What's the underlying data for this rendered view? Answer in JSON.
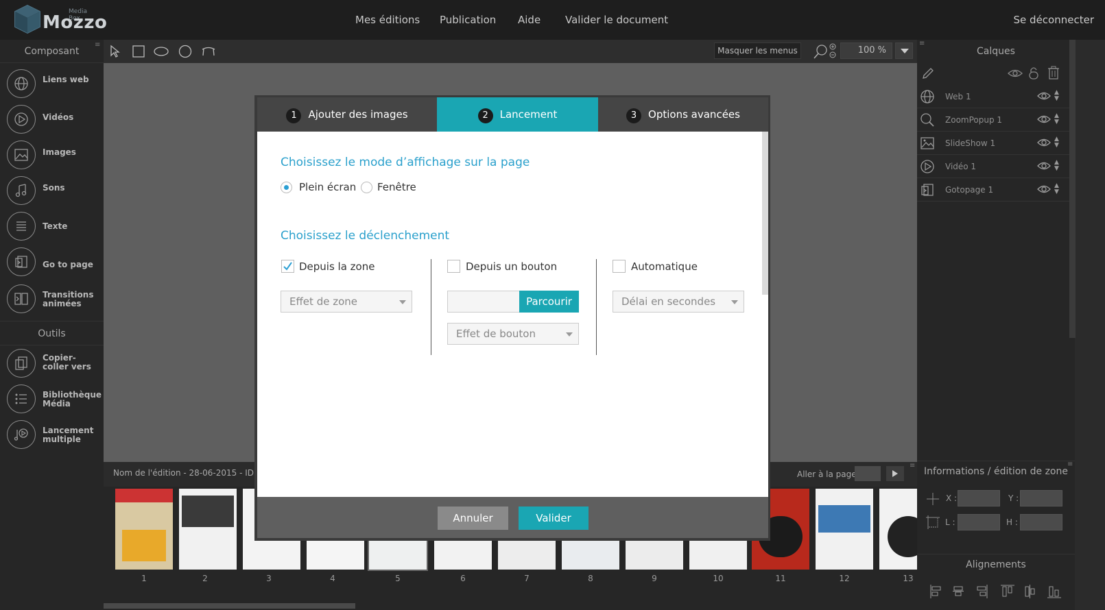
{
  "app": {
    "brand": "Mozzo",
    "brand_sub": "Media Box"
  },
  "nav": {
    "items": [
      "Mes éditions",
      "Publication",
      "Aide",
      "Valider le document"
    ],
    "logout": "Se déconnecter"
  },
  "left_panel": {
    "title": "Composant",
    "items": [
      {
        "label": "Liens web",
        "icon": "globe-icon"
      },
      {
        "label": "Vidéos",
        "icon": "play-icon"
      },
      {
        "label": "Images",
        "icon": "image-icon"
      },
      {
        "label": "Sons",
        "icon": "music-note-icon"
      },
      {
        "label": "Texte",
        "icon": "text-lines-icon"
      },
      {
        "label": "Go to page",
        "icon": "goto-page-icon"
      },
      {
        "label": "Transitions animées",
        "icon": "transitions-icon"
      }
    ],
    "tools_title": "Outils",
    "tools": [
      {
        "label": "Copier-coller vers",
        "icon": "copy-icon"
      },
      {
        "label": "Bibliothèque Média",
        "icon": "list-icon"
      },
      {
        "label": "Lancement multiple",
        "icon": "multi-launch-icon"
      }
    ]
  },
  "toolbar": {
    "hide_menus": "Masquer les menus",
    "zoom": "100 %"
  },
  "right_panel": {
    "title": "Calques",
    "layers": [
      {
        "name": "Web 1",
        "icon": "globe-icon"
      },
      {
        "name": "ZoomPopup 1",
        "icon": "zoom-icon"
      },
      {
        "name": "SlideShow 1",
        "icon": "image-icon"
      },
      {
        "name": "Vidéo 1",
        "icon": "play-icon"
      },
      {
        "name": "Gotopage 1",
        "icon": "goto-page-icon"
      }
    ],
    "info_title": "Informations / édition de zone",
    "x_label": "X :",
    "y_label": "Y :",
    "w_label": "L :",
    "h_label": "H :",
    "align_title": "Alignements"
  },
  "bottom": {
    "edition_name": "Nom de l'édition - 28-06-2015 - ID",
    "goto_label": "Aller à la page",
    "pages": [
      "1",
      "2",
      "3",
      "4",
      "5",
      "6",
      "7",
      "8",
      "9",
      "10",
      "11",
      "12",
      "13"
    ]
  },
  "modal": {
    "tabs": [
      {
        "num": "1",
        "label": "Ajouter des images"
      },
      {
        "num": "2",
        "label": "Lancement"
      },
      {
        "num": "3",
        "label": "Options avancées"
      }
    ],
    "display_title": "Choisissez le mode d’affichage sur la page",
    "display_options": [
      "Plein écran",
      "Fenêtre"
    ],
    "trigger_title": "Choisissez le déclenchement",
    "trigger_zone": "Depuis la zone",
    "trigger_button": "Depuis un bouton",
    "trigger_auto": "Automatique",
    "zone_effect": "Effet de zone",
    "browse": "Parcourir",
    "button_effect": "Effet de bouton",
    "delay": "Délai en secondes",
    "cancel": "Annuler",
    "validate": "Valider"
  },
  "colors": {
    "accent": "#1aa6b3",
    "section_title": "#2aa0cc",
    "topbar": "#1e1e1e"
  }
}
